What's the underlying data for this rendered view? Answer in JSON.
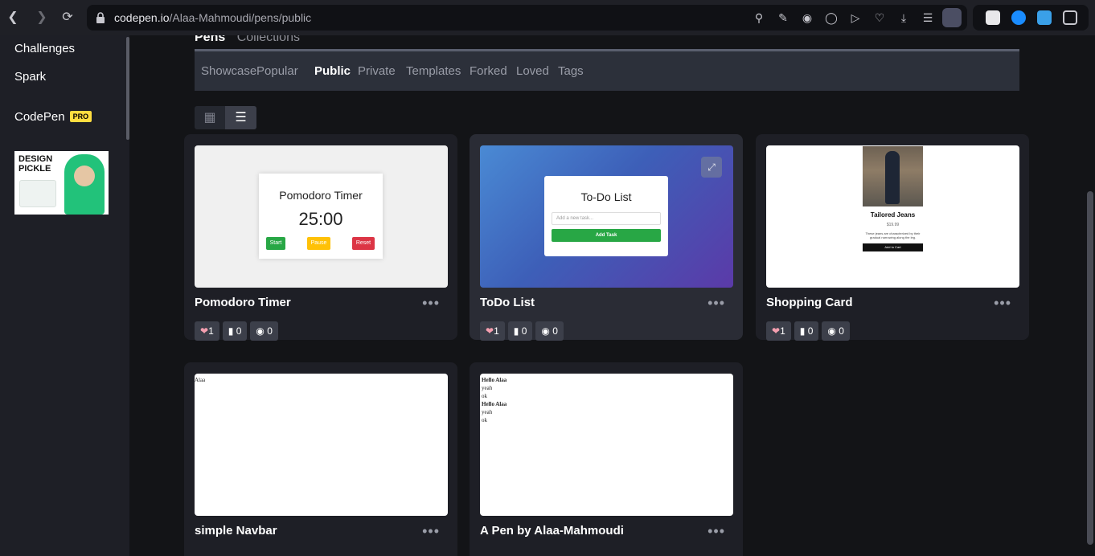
{
  "browser": {
    "url_host": "codepen.io",
    "url_path": "/Alaa-Mahmoudi/pens/public"
  },
  "sidebar": {
    "links": [
      "Challenges",
      "Spark"
    ],
    "codepen_label": "CodePen",
    "pro_badge": "PRO",
    "ad_text": "DESIGN PICKLE"
  },
  "header": {
    "tabs": [
      "Pens",
      "Collections"
    ]
  },
  "filters": [
    "Showcase",
    "Popular",
    "Public",
    "Private",
    "Templates",
    "Forked",
    "Loved",
    "Tags"
  ],
  "active_filter": "Public",
  "pens": [
    {
      "title": "Pomodoro Timer",
      "likes": "1",
      "comments": "0",
      "views": "0",
      "preview": {
        "heading": "Pomodoro Timer",
        "time": "25:00",
        "buttons": [
          "Start",
          "Pause",
          "Reset"
        ]
      }
    },
    {
      "title": "ToDo List",
      "likes": "1",
      "comments": "0",
      "views": "0",
      "preview": {
        "heading": "To-Do List",
        "placeholder": "Add a new task...",
        "button": "Add Task"
      }
    },
    {
      "title": "Shopping Card",
      "likes": "1",
      "comments": "0",
      "views": "0",
      "preview": {
        "product": "Tailored Jeans",
        "price": "$19.99",
        "description": "These jeans are characterized by their gradual narrowing along the leg.",
        "button": "Add to Cart"
      }
    },
    {
      "title": "simple Navbar",
      "preview": {
        "text": "Alaa"
      }
    },
    {
      "title": "A Pen by Alaa-Mahmoudi",
      "preview": {
        "lines": [
          "Hello Alaa",
          "yeah",
          "ok",
          "Hello Alaa",
          "yeah",
          "ok"
        ]
      }
    }
  ],
  "colors": {
    "accent_pro": "#ffdd40",
    "start": "#28a745",
    "pause": "#ffc107",
    "reset": "#dc3545"
  }
}
